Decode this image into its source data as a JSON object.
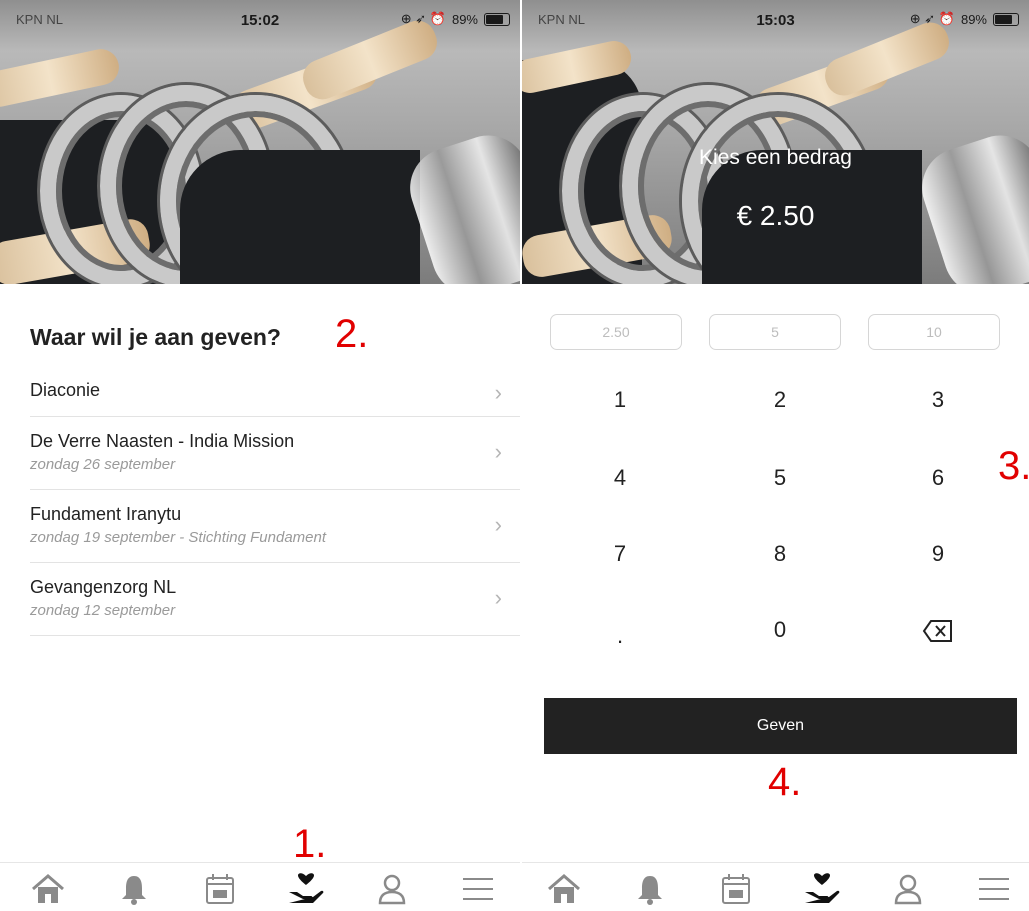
{
  "left_screen": {
    "status": {
      "carrier": "KPN NL",
      "time": "15:02",
      "battery": "89%"
    },
    "heading": "Waar wil je aan geven?",
    "items": [
      {
        "title": "Diaconie",
        "subtitle": ""
      },
      {
        "title": "De Verre Naasten - India Mission",
        "subtitle": "zondag 26 september"
      },
      {
        "title": "Fundament Iranytu",
        "subtitle": "zondag 19 september - Stichting Fundament"
      },
      {
        "title": "Gevangenzorg NL",
        "subtitle": "zondag 12 september"
      }
    ]
  },
  "right_screen": {
    "status": {
      "carrier": "KPN NL",
      "time": "15:03",
      "battery": "89%"
    },
    "title": "Kies een bedrag",
    "amount": "€ 2.50",
    "presets": [
      "2.50",
      "5",
      "10"
    ],
    "keys": [
      "1",
      "2",
      "3",
      "4",
      "5",
      "6",
      "7",
      "8",
      "9",
      ".",
      "0"
    ],
    "give_label": "Geven"
  },
  "annotations": {
    "a1": "1.",
    "a2": "2.",
    "a3": "3.",
    "a4": "4."
  },
  "tabbar_icons": [
    "home-icon",
    "bell-icon",
    "calendar-icon",
    "give-hand-heart-icon",
    "profile-icon",
    "menu-icon"
  ],
  "colors": {
    "annotation": "#e10000",
    "button_bg": "#222222",
    "active_tab": "#111111",
    "inactive_tab": "#8a8a8a"
  }
}
